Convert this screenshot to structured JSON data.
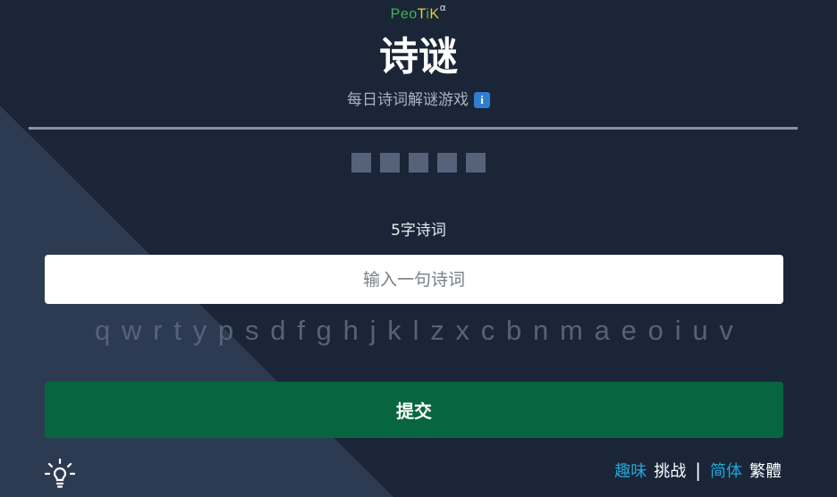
{
  "header": {
    "brand_letters": [
      {
        "text": "P",
        "color": "#3fb950"
      },
      {
        "text": "e",
        "color": "#3fb950"
      },
      {
        "text": "o",
        "color": "#3fb950"
      },
      {
        "text": "T",
        "color": "#f2cc2e"
      },
      {
        "text": "i",
        "color": "#3fb950"
      },
      {
        "text": "K",
        "color": "#f2cc2e"
      }
    ],
    "brand_sup": "α",
    "title": "诗谜",
    "subtitle": "每日诗词解谜游戏",
    "info_icon": "i"
  },
  "puzzle": {
    "slot_count": 5,
    "length_label": "5字诗词"
  },
  "input": {
    "placeholder": "输入一句诗词",
    "value": ""
  },
  "keyboard": {
    "keys": [
      "q",
      "w",
      "r",
      "t",
      "y",
      "p",
      "s",
      "d",
      "f",
      "g",
      "h",
      "j",
      "k",
      "l",
      "z",
      "x",
      "c",
      "b",
      "n",
      "m",
      "a",
      "e",
      "o",
      "i",
      "u",
      "v"
    ]
  },
  "submit_label": "提交",
  "footer": {
    "mode_fun": "趣味",
    "mode_challenge": "挑战",
    "separator": "|",
    "lang_simplified": "简体",
    "lang_traditional": "繁體"
  },
  "colors": {
    "background": "#1a2538",
    "triangle": "#2d3b52",
    "slot": "#56627a",
    "submit": "#07663f",
    "active_link": "#21a7d8"
  },
  "icons": {
    "hint": "lightbulb-icon",
    "info": "info-icon"
  }
}
